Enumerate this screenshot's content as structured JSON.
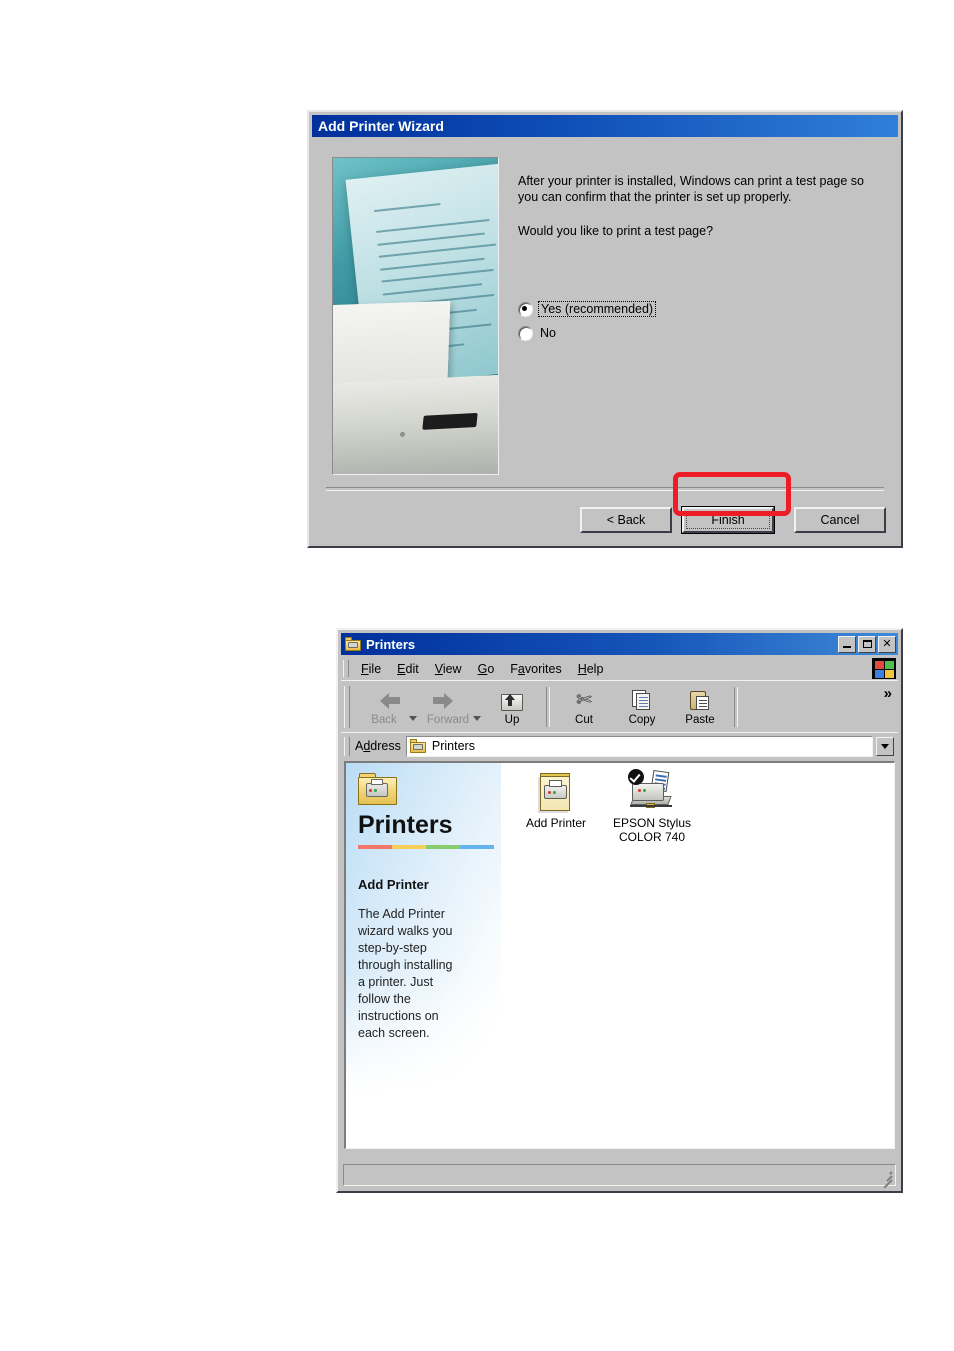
{
  "wizard": {
    "title": "Add Printer Wizard",
    "paragraph1": "After your printer is installed, Windows can print a test page so you can confirm that the printer is set up properly.",
    "paragraph2": "Would you like to print a test page?",
    "options": [
      {
        "label": "Yes (recommended)",
        "selected": true,
        "focused": true
      },
      {
        "label": "No",
        "selected": false,
        "focused": false
      }
    ],
    "buttons": {
      "back": "< Back",
      "finish": "Finish",
      "cancel": "Cancel"
    },
    "highlight_color": "#ee1c25",
    "image_alt": "printer-photo"
  },
  "explorer": {
    "title": "Printers",
    "window_controls": {
      "minimize": "_",
      "maximize": "□",
      "close": "✕"
    },
    "menu": [
      {
        "label": "File"
      },
      {
        "label": "Edit"
      },
      {
        "label": "View"
      },
      {
        "label": "Go"
      },
      {
        "label": "Favorites"
      },
      {
        "label": "Help"
      }
    ],
    "toolbar": {
      "buttons": [
        {
          "label": "Back",
          "disabled": true,
          "icon": "arrow-left-icon"
        },
        {
          "label": "Forward",
          "disabled": true,
          "icon": "arrow-right-icon"
        },
        {
          "label": "Up",
          "disabled": false,
          "icon": "folder-up-icon"
        },
        {
          "label": "Cut",
          "disabled": false,
          "icon": "scissors-icon"
        },
        {
          "label": "Copy",
          "disabled": false,
          "icon": "copy-pages-icon"
        },
        {
          "label": "Paste",
          "disabled": false,
          "icon": "clipboard-icon"
        }
      ],
      "overflow": "»"
    },
    "address": {
      "label": "Address",
      "value": "Printers",
      "icon": "printers-folder-icon"
    },
    "webview": {
      "heading": "Printers",
      "subheading": "Add Printer",
      "description": "The Add Printer wizard walks you step-by-step through installing a printer. Just follow the instructions on each screen.",
      "divider_colors": [
        "#f2776b",
        "#f5cf58",
        "#88cc6e",
        "#63b4ec"
      ]
    },
    "items": [
      {
        "label": "Add Printer",
        "icon": "add-printer-icon"
      },
      {
        "label": "EPSON Stylus COLOR 740",
        "icon": "epson-printer-default-icon"
      }
    ],
    "status_text": ""
  }
}
